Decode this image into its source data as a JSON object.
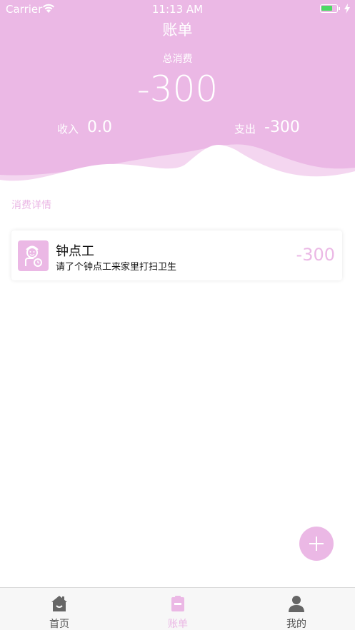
{
  "status_bar": {
    "carrier": "Carrier",
    "time": "11:13 AM"
  },
  "header": {
    "title": "账单",
    "total_label": "总消费",
    "total_value": "-300",
    "income_label": "收入",
    "income_value": "0.0",
    "expense_label": "支出",
    "expense_value": "-300"
  },
  "details": {
    "section_title": "消费详情",
    "records": [
      {
        "title": "钟点工",
        "description": "请了个钟点工来家里打扫卫生",
        "amount": "-300",
        "icon": "housekeeper-icon"
      }
    ]
  },
  "fab": {
    "icon": "plus-icon"
  },
  "tabbar": {
    "tabs": [
      {
        "label": "首页",
        "icon": "home-icon",
        "active": false
      },
      {
        "label": "账单",
        "icon": "bill-icon",
        "active": true
      },
      {
        "label": "我的",
        "icon": "person-icon",
        "active": false
      }
    ]
  },
  "colors": {
    "accent": "#ebb8e5",
    "white": "#ffffff"
  }
}
